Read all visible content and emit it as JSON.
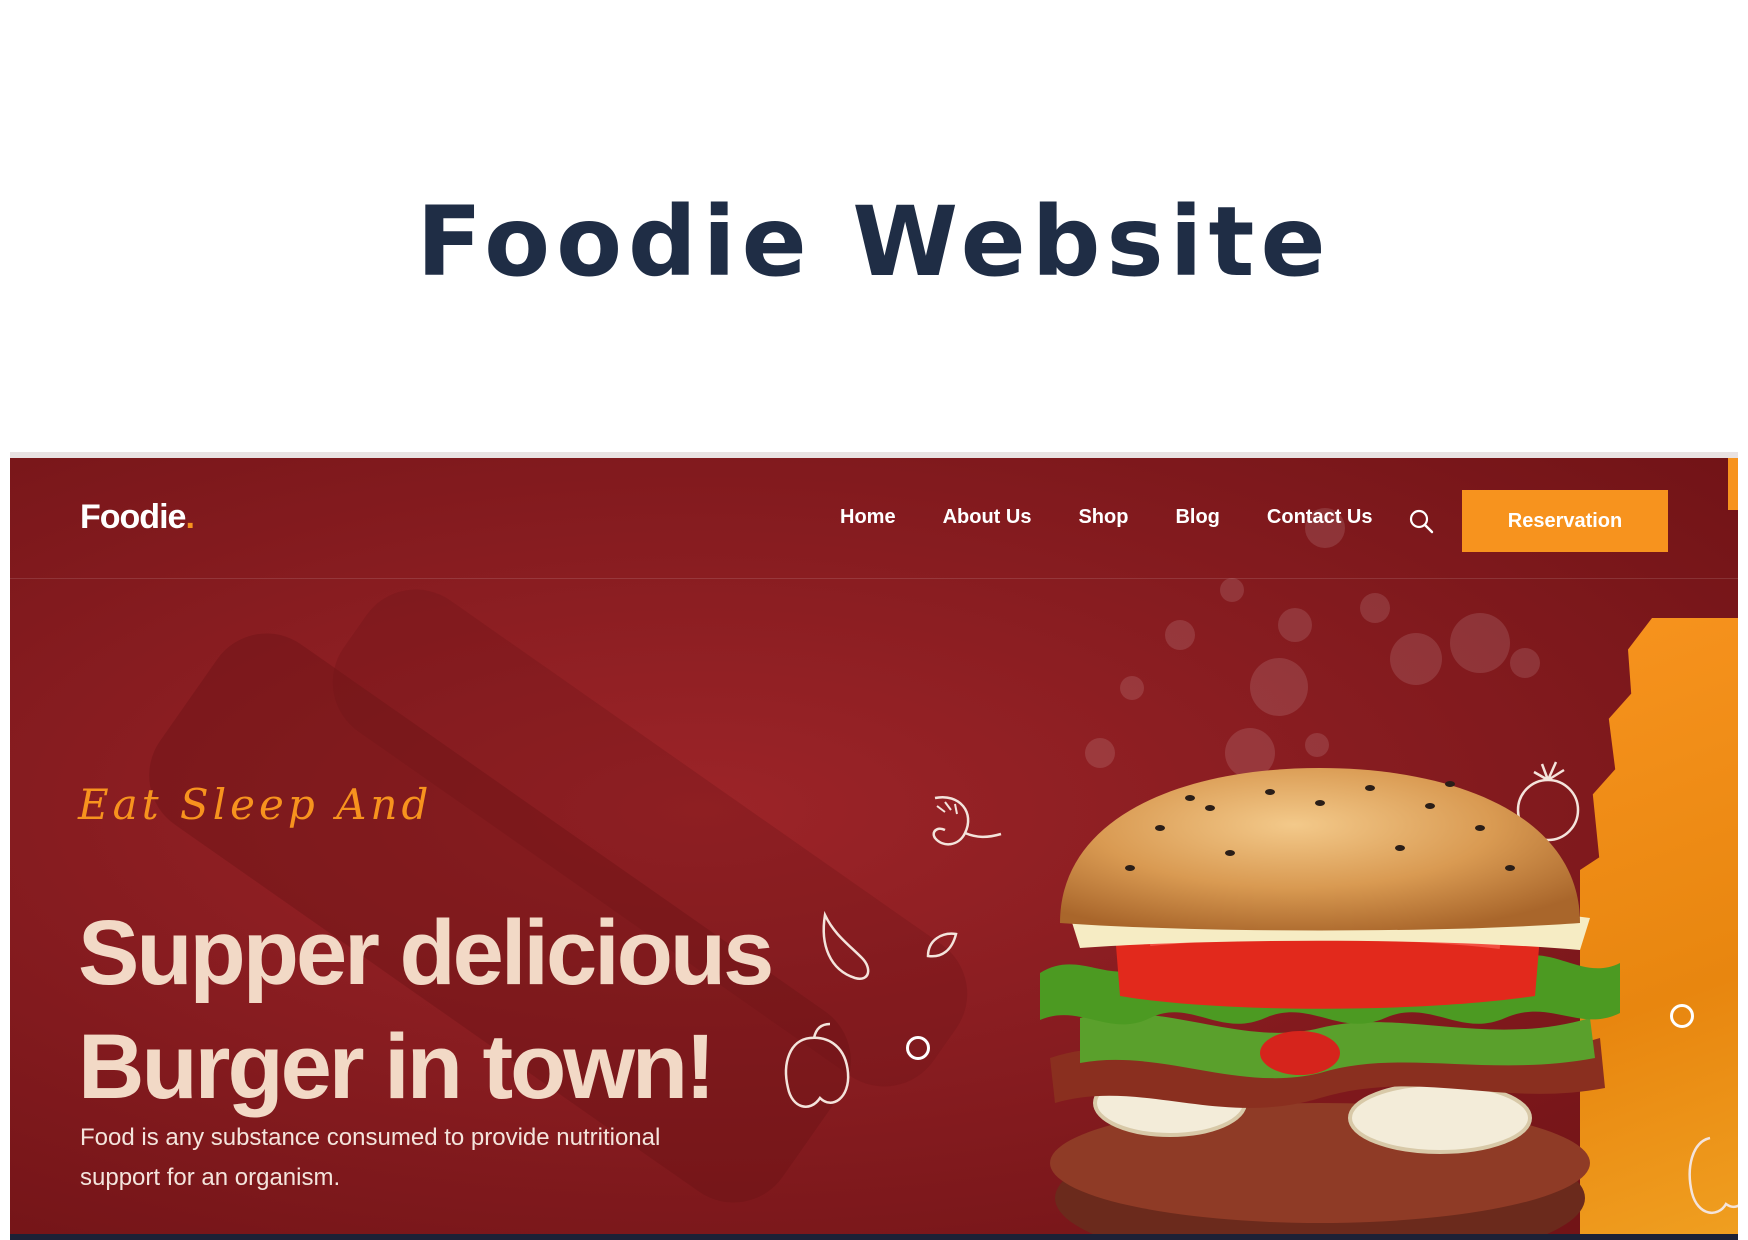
{
  "heading": "Foodie Website",
  "site": {
    "logo": {
      "text": "Foodie",
      "dot": "."
    },
    "nav": {
      "links": [
        "Home",
        "About Us",
        "Shop",
        "Blog",
        "Contact Us"
      ],
      "search_icon": "search-icon",
      "reservation_label": "Reservation"
    },
    "hero": {
      "tagline": "Eat Sleep And",
      "headline_line1": "Supper delicious",
      "headline_line2": "Burger in town!",
      "description": "Food is any substance consumed to provide nutritional support for an organism."
    },
    "colors": {
      "background": "#8b1e22",
      "accent": "#f7931e",
      "headline": "#f2d9c6",
      "title_text": "#1f2d45"
    }
  }
}
